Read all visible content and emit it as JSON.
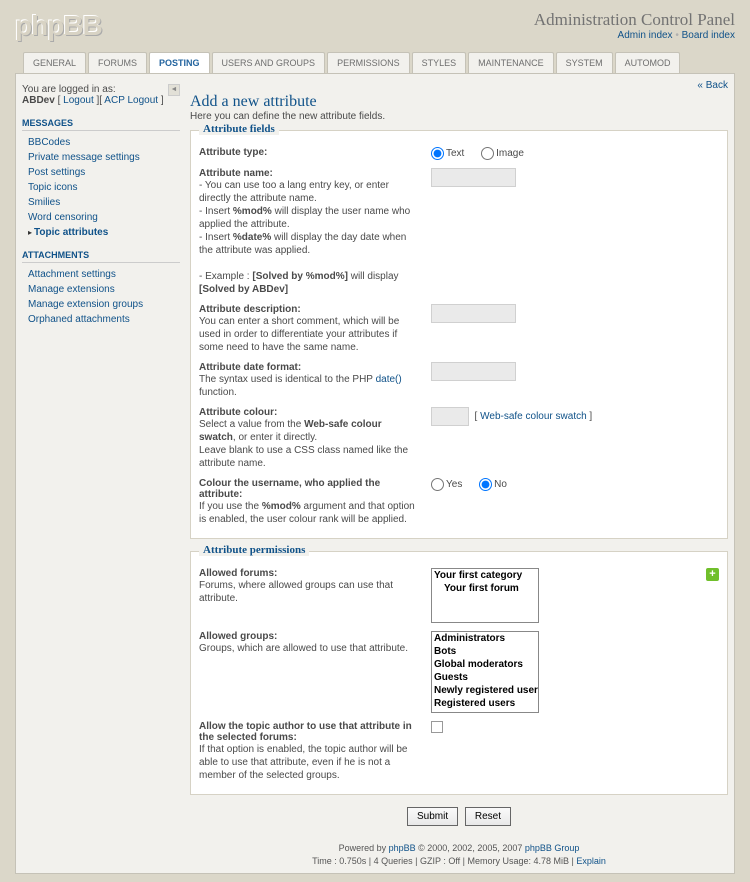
{
  "header": {
    "logo": "phpBB",
    "title": "Administration Control Panel",
    "admin_index": "Admin index",
    "board_index": "Board index"
  },
  "tabs": [
    "GENERAL",
    "FORUMS",
    "POSTING",
    "USERS AND GROUPS",
    "PERMISSIONS",
    "STYLES",
    "MAINTENANCE",
    "SYSTEM",
    "AUTOMOD"
  ],
  "active_tab": "POSTING",
  "login": {
    "text": "You are logged in as:",
    "user": "ABDev",
    "logout": "Logout",
    "acp_logout": "ACP Logout"
  },
  "sidebar": [
    {
      "title": "MESSAGES",
      "items": [
        "BBCodes",
        "Private message settings",
        "Post settings",
        "Topic icons",
        "Smilies",
        "Word censoring",
        "Topic attributes"
      ],
      "active": "Topic attributes"
    },
    {
      "title": "ATTACHMENTS",
      "items": [
        "Attachment settings",
        "Manage extensions",
        "Manage extension groups",
        "Orphaned attachments"
      ]
    }
  ],
  "back": "Back",
  "page": {
    "title": "Add a new attribute",
    "sub": "Here you can define the new attribute fields."
  },
  "fieldsets": {
    "fields": {
      "legend": "Attribute fields",
      "type": {
        "label": "Attribute type:",
        "opt1": "Text",
        "opt2": "Image"
      },
      "name": {
        "label": "Attribute name:",
        "hint1": "- You can use too a lang entry key, or enter directly the attribute name.",
        "hint2a": "- Insert ",
        "hint2b": "%mod%",
        "hint2c": " will display the user name who applied the attribute.",
        "hint3a": "- Insert ",
        "hint3b": "%date%",
        "hint3c": " will display the day date when the attribute was applied.",
        "hint4a": "- Example : ",
        "hint4b": "[Solved by %mod%]",
        "hint4c": " will display ",
        "hint4d": "[Solved by ABDev]"
      },
      "desc": {
        "label": "Attribute description:",
        "hint": "You can enter a short comment, which will be used in order to differentiate your attributes if some need to have the same name."
      },
      "date": {
        "label": "Attribute date format:",
        "hint1": "The syntax used is identical to the PHP ",
        "hint2": "date()",
        "hint3": " function."
      },
      "colour": {
        "label": "Attribute colour:",
        "hint1a": "Select a value from the ",
        "hint1b": "Web-safe colour swatch",
        "hint1c": ", or enter it directly.",
        "hint2": "Leave blank to use a CSS class named like the attribute name.",
        "swatch": "Web-safe colour swatch"
      },
      "usercolour": {
        "label": "Colour the username, who applied the attribute:",
        "hint1a": "If you use the ",
        "hint1b": "%mod%",
        "hint1c": " argument and that option is enabled, the user colour rank will be applied.",
        "yes": "Yes",
        "no": "No"
      }
    },
    "perms": {
      "legend": "Attribute permissions",
      "forums": {
        "label": "Allowed forums:",
        "hint": "Forums, where allowed groups can use that attribute.",
        "options": [
          {
            "text": "Your first category",
            "indent": false
          },
          {
            "text": "Your first forum",
            "indent": true
          }
        ]
      },
      "groups": {
        "label": "Allowed groups:",
        "hint": "Groups, which are allowed to use that attribute.",
        "options": [
          "Administrators",
          "Bots",
          "Global moderators",
          "Guests",
          "Newly registered users",
          "Registered users"
        ]
      },
      "author": {
        "label": "Allow the topic author to use that attribute in the selected forums:",
        "hint": "If that option is enabled, the topic author will be able to use that attribute, even if he is not a member of the selected groups."
      }
    }
  },
  "buttons": {
    "submit": "Submit",
    "reset": "Reset"
  },
  "footer": {
    "line1a": "Powered by ",
    "line1b": "phpBB",
    "line1c": " © 2000, 2002, 2005, 2007 ",
    "line1d": "phpBB Group",
    "line2": "Time : 0.750s | 4 Queries | GZIP : Off | Memory Usage: 4.78 MiB | ",
    "explain": "Explain"
  }
}
